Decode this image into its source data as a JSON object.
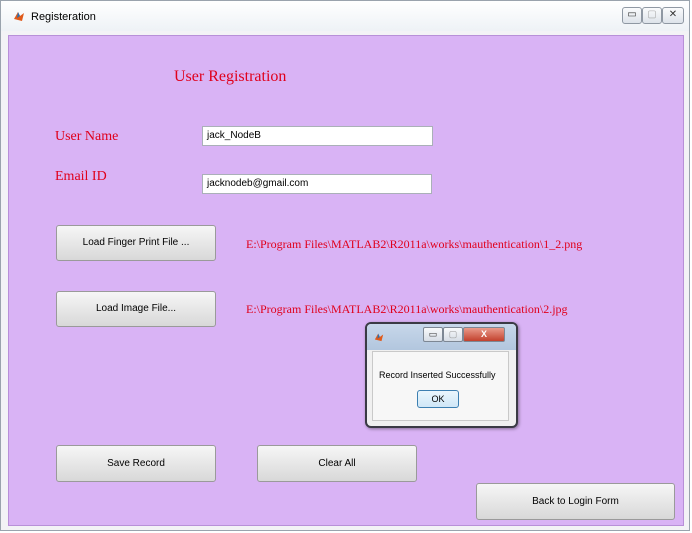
{
  "window": {
    "title": "Registeration",
    "controls": {
      "minimize": "▭",
      "maximize": "▢",
      "close": "✕"
    }
  },
  "form": {
    "heading": "User Registration",
    "username_label": "User Name",
    "username_value": "jack_NodeB",
    "email_label": "Email ID",
    "email_value": "jacknodeb@gmail.com",
    "load_fingerprint_button": "Load Finger Print File ...",
    "fingerprint_path": "E:\\Program Files\\MATLAB2\\R2011a\\works\\mauthentication\\1_2.png",
    "load_image_button": "Load Image File...",
    "image_path": "E:\\Program Files\\MATLAB2\\R2011a\\works\\mauthentication\\2.jpg",
    "save_button": "Save Record",
    "clear_button": "Clear All",
    "back_button": "Back to Login Form"
  },
  "dialog": {
    "message": "Record Inserted Successfully",
    "ok_button": "OK",
    "controls": {
      "minimize": "▭",
      "maximize": "▢",
      "close": "X"
    }
  },
  "colors": {
    "client_background": "#d9b3f5",
    "label_text": "#e0001c"
  },
  "icons": {
    "app": "matlab-icon"
  }
}
